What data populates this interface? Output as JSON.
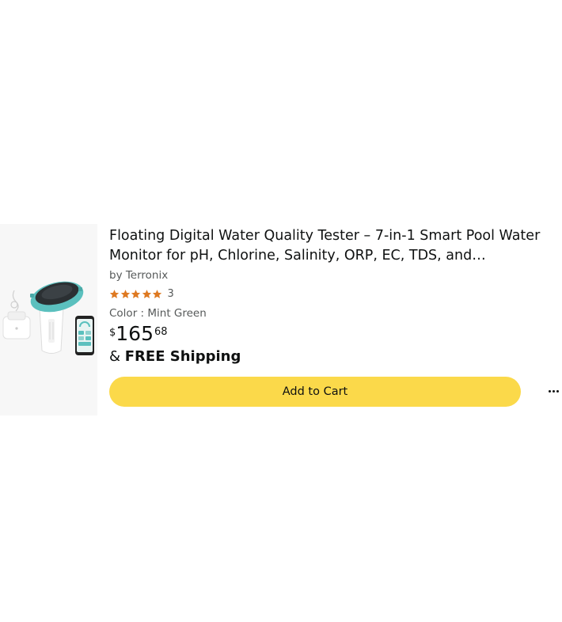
{
  "product": {
    "title": "Floating Digital Water Quality Tester – 7-in-1 Smart Pool Water Monitor for pH, Chlorine, Salinity, ORP, EC, TDS, and Temperature",
    "brand": "by Terronix",
    "rating": {
      "stars": 5,
      "count": "3"
    },
    "color_label": "Color : Mint Green",
    "price": {
      "symbol": "$",
      "whole": "165",
      "fraction": "68"
    },
    "shipping": {
      "prefix": "&",
      "label": "FREE Shipping"
    },
    "image": {
      "icon": "pool-tester-product-image",
      "accent_color": "#5bc0be"
    }
  },
  "actions": {
    "add_to_cart": "Add to Cart",
    "more_options_icon": "ellipsis-icon"
  },
  "colors": {
    "button": "#fbd94a",
    "star": "#de7921",
    "secondary_text": "#565959"
  }
}
